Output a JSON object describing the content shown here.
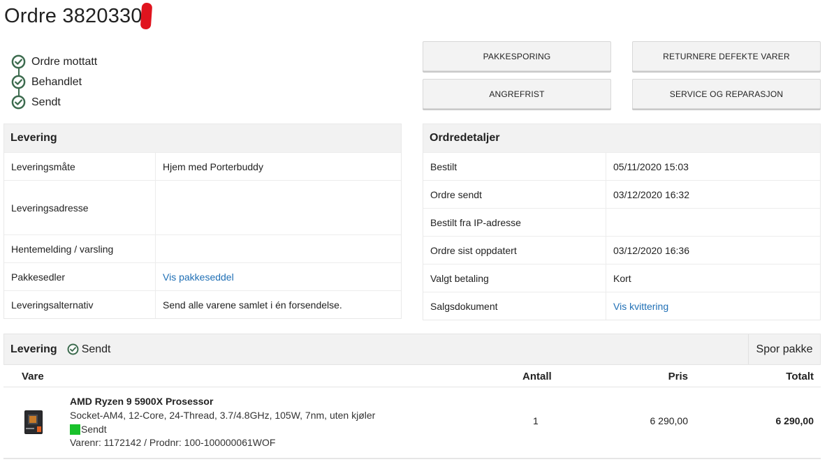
{
  "order": {
    "title": "Ordre 3820330"
  },
  "status_steps": [
    {
      "label": "Ordre mottatt"
    },
    {
      "label": "Behandlet"
    },
    {
      "label": "Sendt"
    }
  ],
  "actions": {
    "tracking": "PAKKESPORING",
    "return_defect": "RETURNERE DEFEKTE VARER",
    "withdrawal": "ANGREFRIST",
    "service": "SERVICE OG REPARASJON"
  },
  "delivery_panel": {
    "title": "Levering",
    "rows": [
      {
        "key": "Leveringsmåte",
        "value": "Hjem med Porterbuddy"
      },
      {
        "key": "Leveringsadresse",
        "value": ""
      },
      {
        "key": "Hentemelding / varsling",
        "value": ""
      },
      {
        "key": "Pakkesedler",
        "value": "Vis pakkeseddel"
      },
      {
        "key": "Leveringsalternativ",
        "value": "Send alle varene samlet i én forsendelse."
      }
    ]
  },
  "order_panel": {
    "title": "Ordredetaljer",
    "rows": [
      {
        "key": "Bestilt",
        "value": "05/11/2020 15:03"
      },
      {
        "key": "Ordre sendt",
        "value": "03/12/2020 16:32"
      },
      {
        "key": "Bestilt fra IP-adresse",
        "value": ""
      },
      {
        "key": "Ordre sist oppdatert",
        "value": "03/12/2020 16:36"
      },
      {
        "key": "Valgt betaling",
        "value": "Kort"
      },
      {
        "key": "Salgsdokument",
        "value": "Vis kvittering"
      }
    ]
  },
  "shipment": {
    "title": "Levering",
    "status": "Sendt",
    "track_label": "Spor pakke",
    "columns": {
      "item": "Vare",
      "qty": "Antall",
      "price": "Pris",
      "total": "Totalt"
    },
    "items": [
      {
        "name": "AMD Ryzen 9 5900X Prosessor",
        "spec": "Socket-AM4, 12-Core, 24-Thread, 3.7/4.8GHz, 105W, 7nm, uten kjøler",
        "status": "Sendt",
        "numbers": "Varenr: 1172142 / Prodnr: 100-100000061WOF",
        "qty": "1",
        "price": "6 290,00",
        "total": "6 290,00"
      }
    ]
  },
  "colors": {
    "check_green": "#3c6b4e",
    "link_blue": "#1f6fb5",
    "status_green": "#19c12b",
    "redact_red": "#e0141e"
  }
}
